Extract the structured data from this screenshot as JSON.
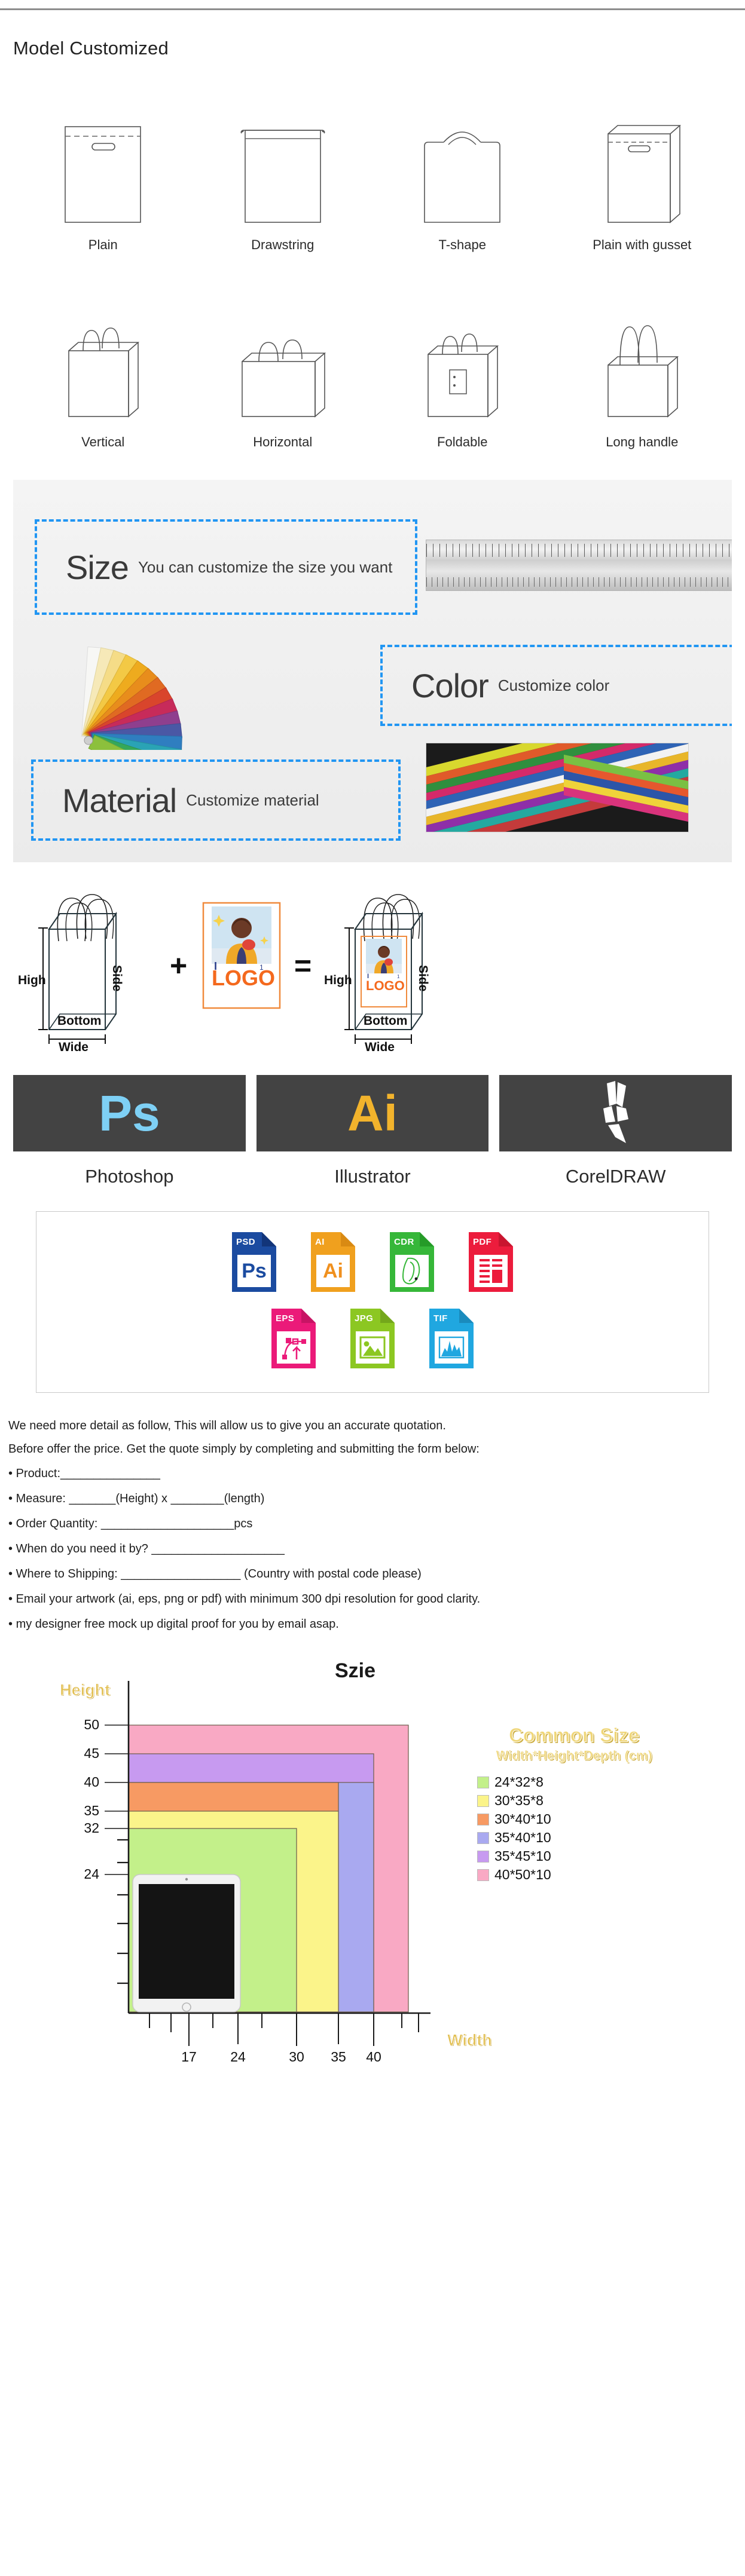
{
  "models": {
    "title": "Model Customized",
    "row1": [
      {
        "label": "Plain",
        "icon": "plain-bag-icon"
      },
      {
        "label": "Drawstring",
        "icon": "drawstring-bag-icon"
      },
      {
        "label": "T-shape",
        "icon": "t-shape-bag-icon"
      },
      {
        "label": "Plain with gusset",
        "icon": "plain-with-gusset-bag-icon"
      }
    ],
    "row2": [
      {
        "label": "Vertical",
        "icon": "vertical-bag-icon"
      },
      {
        "label": "Horizontal",
        "icon": "horizontal-bag-icon"
      },
      {
        "label": "Foldable",
        "icon": "foldable-bag-icon"
      },
      {
        "label": "Long handle",
        "icon": "long-handle-bag-icon"
      }
    ]
  },
  "customization": {
    "size": {
      "title": "Size",
      "desc": "You can customize the size you want"
    },
    "color": {
      "title": "Color",
      "desc": "Customize color"
    },
    "material": {
      "title": "Material",
      "desc": "Customize material"
    },
    "accent_color": "#2196f3"
  },
  "equation": {
    "bag": {
      "high": "High",
      "side": "Side",
      "bottom": "Bottom",
      "wide": "Wide"
    },
    "plus": "+",
    "equals": "=",
    "logo_text": "LOGO",
    "logo_border_color": "#f08a3c",
    "logo_text_color": "#f4691d"
  },
  "software": [
    {
      "name": "Photoshop",
      "glyph": "Ps",
      "color": "#7ed0f5",
      "tile": "#434343"
    },
    {
      "name": "Illustrator",
      "glyph": "Ai",
      "color": "#f2b32c",
      "tile": "#434343"
    },
    {
      "name": "CorelDRAW",
      "glyph": "",
      "color": "#ffffff",
      "tile": "#434343"
    }
  ],
  "file_formats": {
    "row1": [
      {
        "tag": "PSD",
        "mark": "Ps",
        "color": "#1b4ba0",
        "mark_color": "#1b4ba0"
      },
      {
        "tag": "AI",
        "mark": "Ai",
        "color": "#f0a01e",
        "mark_color": "#f0901e"
      },
      {
        "tag": "CDR",
        "mark": "",
        "color": "#36b739",
        "mark_color": "#36b739"
      },
      {
        "tag": "PDF",
        "mark": "",
        "color": "#ec1c3c",
        "mark_color": "#ec1c3c"
      }
    ],
    "row2": [
      {
        "tag": "EPS",
        "mark": "",
        "color": "#eb1a79",
        "mark_color": "#eb1a79"
      },
      {
        "tag": "JPG",
        "mark": "",
        "color": "#8cc722",
        "mark_color": "#8cc722"
      },
      {
        "tag": "TIF",
        "mark": "",
        "color": "#20a7e0",
        "mark_color": "#20a7e0"
      }
    ]
  },
  "quote_form": {
    "intro1": "We need more detail as follow, This will allow us to give you an accurate quotation.",
    "intro2": "Before offer the price. Get the quote simply by completing and submitting the form below:",
    "items": [
      "Product:_______________",
      "Measure: _______(Height) x ________(length)",
      "Order Quantity: ____________________pcs",
      "When do you need it by? ____________________",
      "Where to Shipping: __________________ (Country with postal code please)",
      "Email your artwork (ai, eps, png or pdf) with minimum 300 dpi resolution for good clarity.",
      "my designer free mock up digital proof for you by email asap."
    ]
  },
  "chart_data": {
    "type": "bar",
    "title": "Szie",
    "xlabel": "Width",
    "ylabel": "Height",
    "legend_title": "Common Size",
    "legend_subtitle": "Width*Height*Depth (cm)",
    "legend_position": "right",
    "grid": false,
    "xlim": [
      0,
      60
    ],
    "ylim": [
      0,
      55
    ],
    "xticks": [
      17,
      24,
      30,
      35,
      40
    ],
    "yticks": [
      24,
      32,
      35,
      40,
      45,
      50
    ],
    "series": [
      {
        "name": "24*32*8",
        "width": 24,
        "height": 32,
        "depth": 8,
        "color": "#c3f08a"
      },
      {
        "name": "30*35*8",
        "width": 30,
        "height": 35,
        "depth": 8,
        "color": "#fbf48a"
      },
      {
        "name": "30*40*10",
        "width": 30,
        "height": 40,
        "depth": 10,
        "color": "#f79a63"
      },
      {
        "name": "35*40*10",
        "width": 35,
        "height": 40,
        "depth": 10,
        "color": "#a9a9f0"
      },
      {
        "name": "35*45*10",
        "width": 35,
        "height": 45,
        "depth": 10,
        "color": "#c79af0"
      },
      {
        "name": "40*50*10",
        "width": 40,
        "height": 50,
        "depth": 10,
        "color": "#f9a9c4"
      }
    ],
    "reference_object": "tablet-device"
  }
}
